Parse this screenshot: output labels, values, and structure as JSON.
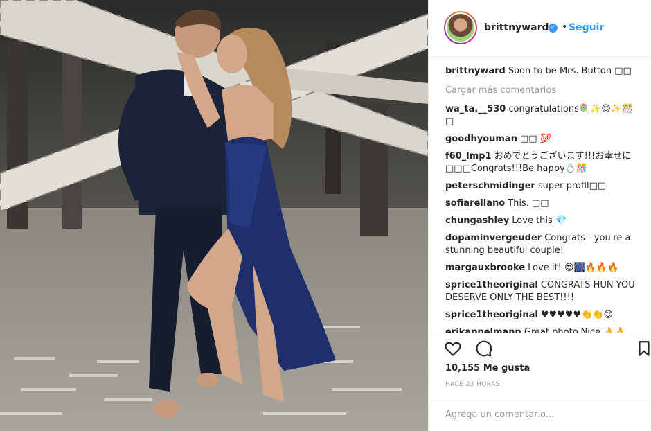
{
  "post": {
    "username": "brittnyward",
    "follow_label": "Seguir",
    "dot": "•",
    "verified_mark": "✓",
    "caption": {
      "user": "brittnyward",
      "text": "Soon to be Mrs. Button □□"
    },
    "load_more": "Cargar más comentarios",
    "comments": [
      {
        "user": "wa_ta.__530",
        "text": "congratulations🍭✨😍✨🎊□"
      },
      {
        "user": "goodhyouman",
        "text": "□□ 💯"
      },
      {
        "user": "f60_lmp1",
        "text": "おめでとうございます!!!お幸せに□□□Congrats!!!Be happy💍🎊"
      },
      {
        "user": "peterschmidinger",
        "text": "super profil□□"
      },
      {
        "user": "sofiarellano",
        "text": "This. □□"
      },
      {
        "user": "chungashley",
        "text": "Love this 💎"
      },
      {
        "user": "dopaminvergeuder",
        "text": "Congrats - you're a stunning beautiful couple!"
      },
      {
        "user": "margauxbrooke",
        "text": "Love it! 😍🎆🔥🔥🔥"
      },
      {
        "user": "sprice1theoriginal",
        "text": "CONGRATS HUN YOU DESERVE ONLY THE BEST!!!!"
      },
      {
        "user": "sprice1theoriginal",
        "text": "♥♥♥♥♥👏👏😍"
      },
      {
        "user": "erikappelmann",
        "text": "Great photo.Nice.👌👌"
      }
    ],
    "likes": "10,155 Me gusta",
    "time": "HACE 23 HORAS",
    "comment_placeholder": "Agrega un comentario..."
  },
  "icons": {
    "like": "heart-outline-icon",
    "comment": "comment-bubble-icon",
    "save": "bookmark-icon",
    "verified": "verified-badge-icon"
  },
  "colors": {
    "accent": "#3897f0",
    "muted": "#999999",
    "text": "#262626",
    "dress": "#1f2f6b",
    "suit": "#1b2338"
  }
}
